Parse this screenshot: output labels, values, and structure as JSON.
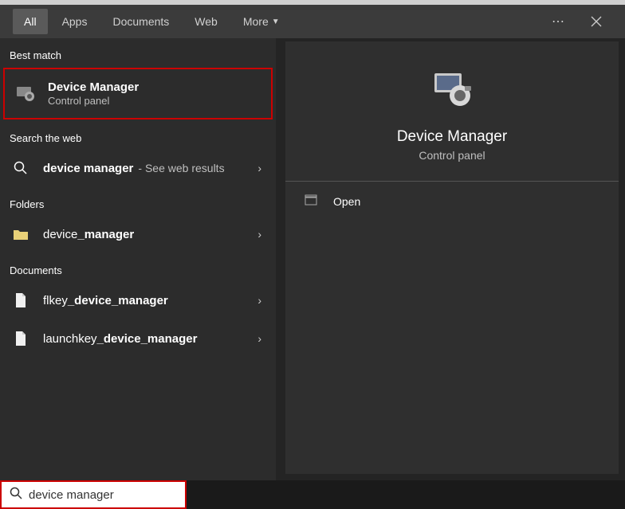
{
  "header": {
    "tabs": {
      "all": "All",
      "apps": "Apps",
      "documents": "Documents",
      "web": "Web",
      "more": "More"
    }
  },
  "sections": {
    "best_match": "Best match",
    "search_web": "Search the web",
    "folders": "Folders",
    "documents": "Documents"
  },
  "best_match": {
    "title": "Device Manager",
    "subtitle": "Control panel"
  },
  "web": {
    "query": "device manager",
    "suffix": "- See web results"
  },
  "folders": {
    "item1_prefix": "device",
    "item1_bold": "_manager"
  },
  "documents": {
    "item1_prefix": "flkey",
    "item1_bold": "_device_manager",
    "item2_prefix": "launchkey",
    "item2_bold": "_device_manager"
  },
  "preview": {
    "title": "Device Manager",
    "subtitle": "Control panel",
    "open": "Open"
  },
  "search": {
    "value": "device manager"
  }
}
